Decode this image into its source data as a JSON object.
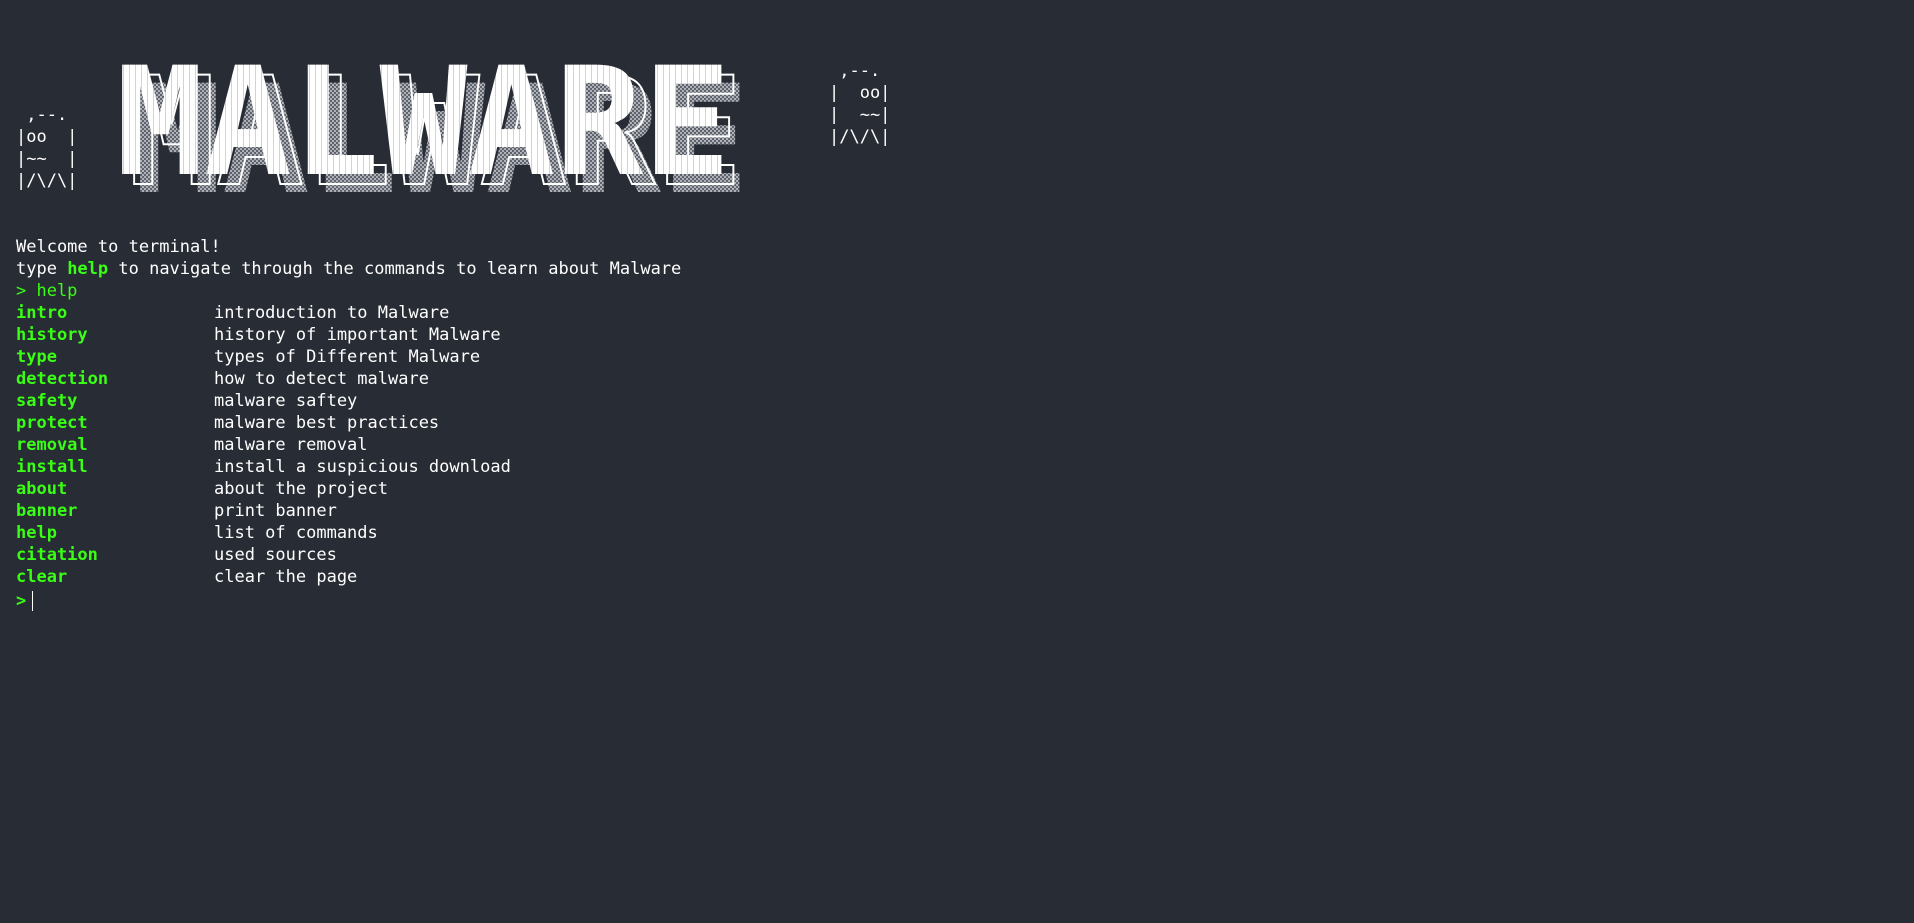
{
  "banner": {
    "logo_text": "MALWARE",
    "ghost_left": " ,--.\n|oo  |\n|~~  |\n|/\\/\\|",
    "ghost_right": " ,--.\n|  oo|\n|  ~~|\n|/\\/\\|"
  },
  "intro": {
    "welcome": "Welcome to terminal!",
    "hint_pre": "type ",
    "hint_cmd": "help",
    "hint_post": " to navigate through the commands to learn about Malware"
  },
  "history": {
    "entered_command": "> help"
  },
  "commands": [
    {
      "name": "intro",
      "desc": "introduction to Malware"
    },
    {
      "name": "history",
      "desc": "history of important Malware"
    },
    {
      "name": "type",
      "desc": "types of Different Malware"
    },
    {
      "name": "detection",
      "desc": "how to detect malware"
    },
    {
      "name": "safety",
      "desc": "malware saftey"
    },
    {
      "name": "protect",
      "desc": "malware best practices"
    },
    {
      "name": "removal",
      "desc": "malware removal"
    },
    {
      "name": "install",
      "desc": "install a suspicious download"
    },
    {
      "name": "about",
      "desc": "about the project"
    },
    {
      "name": "banner",
      "desc": "print banner"
    },
    {
      "name": "help",
      "desc": "list of commands"
    },
    {
      "name": "citation",
      "desc": "used sources"
    },
    {
      "name": "clear",
      "desc": "clear the page"
    }
  ],
  "input": {
    "prompt": ">",
    "value": ""
  },
  "colors": {
    "background": "#282c35",
    "accent": "#39ff14",
    "text": "#ffffff"
  }
}
